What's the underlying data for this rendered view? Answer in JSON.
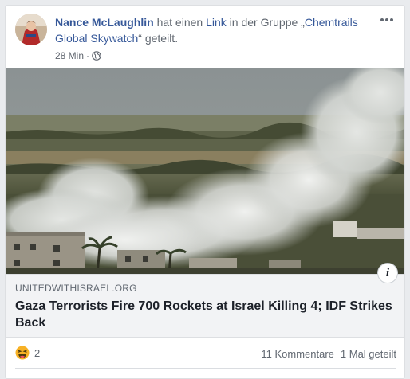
{
  "post": {
    "author": "Nance McLaughlin",
    "action_prefix": " hat einen ",
    "link_word": "Link",
    "action_middle": " in der Gruppe „",
    "group": "Chemtrails Global Skywatch",
    "action_suffix": "“ geteilt.",
    "timestamp": "28 Min",
    "meta_separator": "·",
    "privacy_icon": "globe-icon",
    "menu_icon": "more-horizontal-icon"
  },
  "link_preview": {
    "domain": "UNITEDWITHISRAEL.ORG",
    "headline": "Gaza Terrorists Fire 700 Rockets at Israel Killing 4; IDF Strikes Back",
    "info_badge": "i",
    "image_icon": "smoke-landscape-photo"
  },
  "engagement": {
    "reaction_icon": "haha-emoji-icon",
    "reaction_count": "2",
    "comments": "11 Kommentare",
    "shares": "1 Mal geteilt"
  },
  "colors": {
    "link_blue": "#365899",
    "text_gray": "#606770",
    "headline": "#1d2129",
    "preview_bg": "#f2f3f5",
    "reaction_yellow": "#f7b125"
  }
}
